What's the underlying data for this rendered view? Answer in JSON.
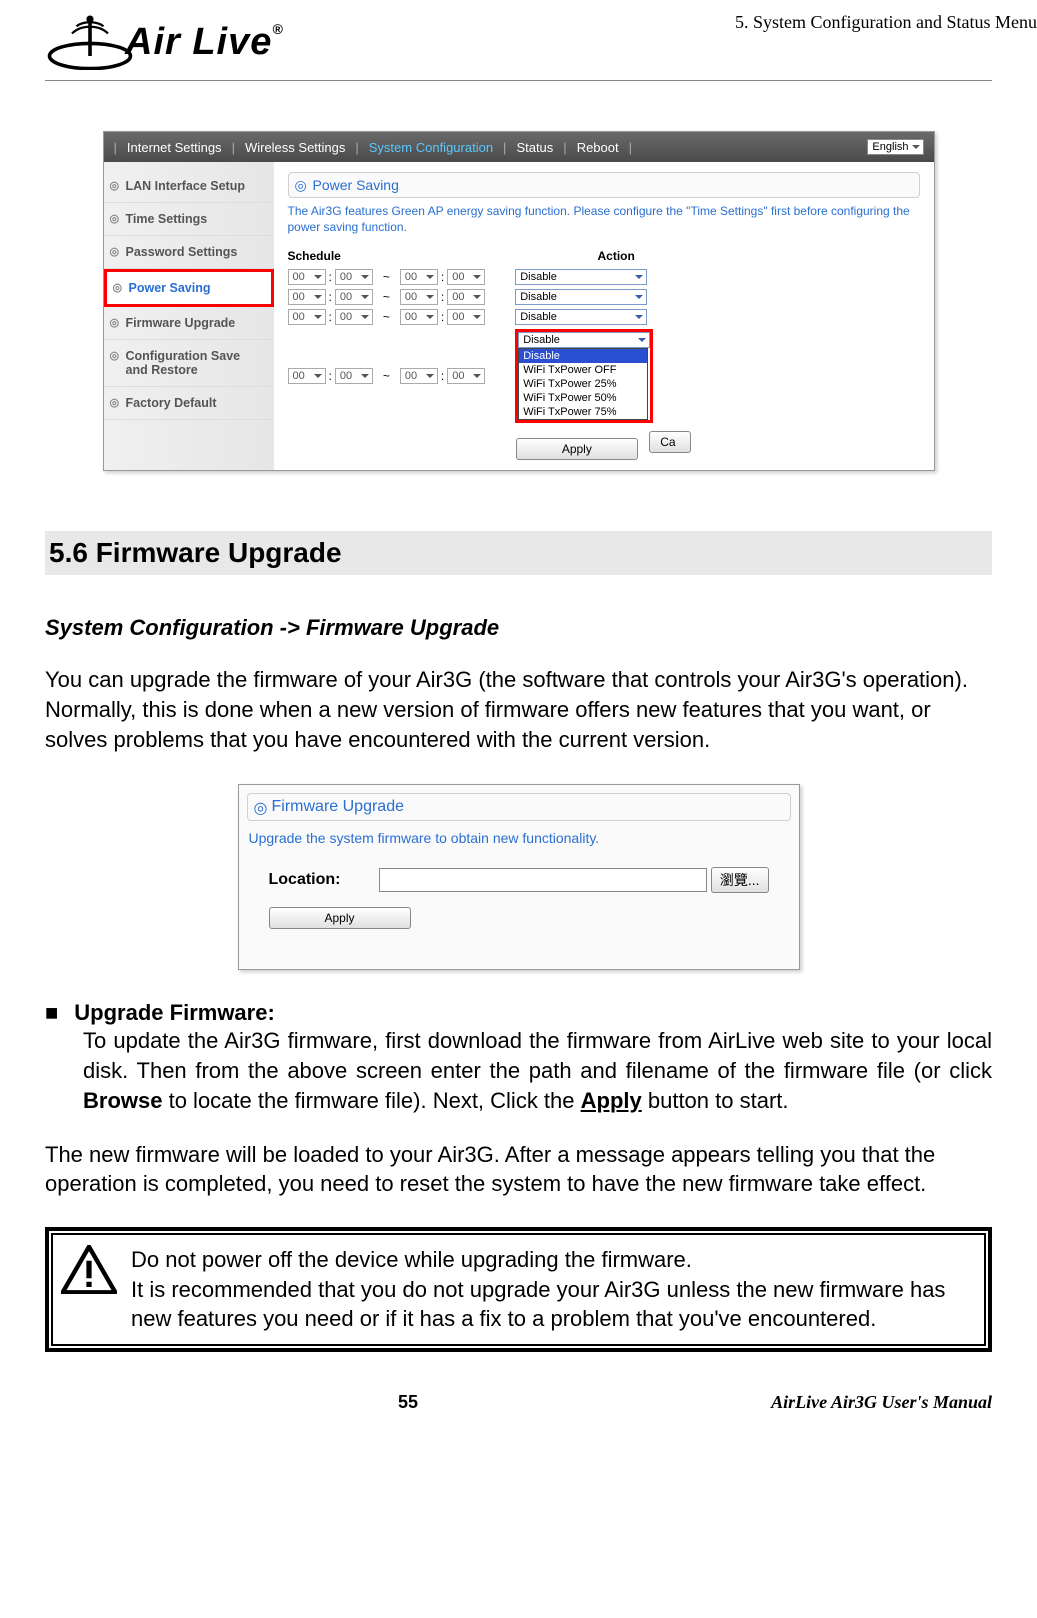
{
  "header": {
    "chapter": "5. System Configuration and Status Menu",
    "logo_text": "Air Live",
    "logo_reg": "®"
  },
  "screenshot1": {
    "nav": [
      "Internet Settings",
      "Wireless Settings",
      "System Configuration",
      "Status",
      "Reboot"
    ],
    "nav_active_index": 2,
    "lang": "English",
    "sidenav": [
      "LAN Interface Setup",
      "Time Settings",
      "Password Settings",
      "Power Saving",
      "Firmware Upgrade",
      "Configuration Save and Restore",
      "Factory Default"
    ],
    "sidenav_highlight": 3,
    "panel_title": "Power Saving",
    "intro": "The Air3G features Green AP energy saving function. Please configure the \"Time Settings\" first before configuring the power saving function.",
    "cols": {
      "schedule": "Schedule",
      "action": "Action"
    },
    "time_opt": "00",
    "action_default": "Disable",
    "dropdown_options": [
      "Disable",
      "WiFi TxPower OFF",
      "WiFi TxPower 25%",
      "WiFi TxPower 50%",
      "WiFi TxPower 75%"
    ],
    "apply": "Apply",
    "cancel_stub": "Ca"
  },
  "section": {
    "heading": "5.6 Firmware Upgrade",
    "breadcrumb": "System Configuration -> Firmware Upgrade",
    "para1": "You can upgrade the firmware of your Air3G (the software that controls your Air3G's operation). Normally, this is done when a new version of firmware offers new features that you want, or solves problems that you have encountered with the current version."
  },
  "screenshot2": {
    "panel_title": "Firmware Upgrade",
    "intro": "Upgrade the system firmware to obtain new functionality.",
    "location_label": "Location:",
    "browse": "瀏覽...",
    "apply": "Apply"
  },
  "bullet": {
    "title": "Upgrade Firmware:",
    "body_a": "To update the Air3G firmware, first download the firmware from AirLive web site to your local disk.   Then from the above screen enter the path and filename of the firmware file (or click ",
    "body_b": "Browse",
    "body_c": " to locate the firmware file). Next, Click the ",
    "body_d": "Apply",
    "body_e": " button to start."
  },
  "para2": "The new firmware will be loaded to your Air3G. After a message appears telling you that the operation is completed, you need to reset the system to have the new firmware take effect.",
  "warning": "Do not power off the device while upgrading the firmware.\nIt is recommended that you do not upgrade your Air3G unless the new firmware has new features you need or if it has a fix to a problem that you've encountered.",
  "footer": {
    "page": "55",
    "manual": "AirLive Air3G User's Manual"
  }
}
